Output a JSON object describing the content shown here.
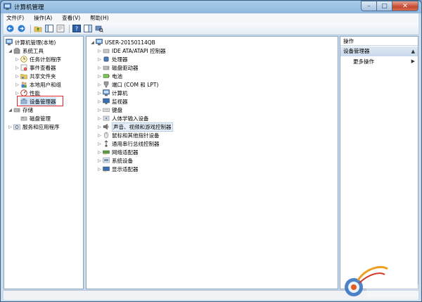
{
  "window": {
    "title": "计算机管理"
  },
  "menu": [
    "文件(F)",
    "操作(A)",
    "查看(V)",
    "帮助(H)"
  ],
  "left_tree": {
    "root": "计算机管理(本地)",
    "system_tools": "系统工具",
    "items": [
      "任务计划程序",
      "事件查看器",
      "共享文件夹",
      "本地用户和组",
      "性能",
      "设备管理器"
    ],
    "storage": "存储",
    "disk_mgmt": "磁盘管理",
    "services": "服务和应用程序"
  },
  "device_tree": {
    "computer": "USER-20150114QB",
    "categories": [
      "IDE ATA/ATAPI 控制器",
      "处理器",
      "磁盘驱动器",
      "电池",
      "端口 (COM 和 LPT)",
      "计算机",
      "监视器",
      "键盘",
      "人体学输入设备",
      "声音、视频和游戏控制器",
      "鼠标和其他指针设备",
      "通用串行总线控制器",
      "网络适配器",
      "系统设备",
      "显示适配器"
    ]
  },
  "actions": {
    "header": "操作",
    "section": "设备管理器",
    "more": "更多操作"
  },
  "colors": {
    "highlight_box": "#e0282a",
    "title_bar": "#a9cbe8",
    "selection": "#cde3f7"
  }
}
